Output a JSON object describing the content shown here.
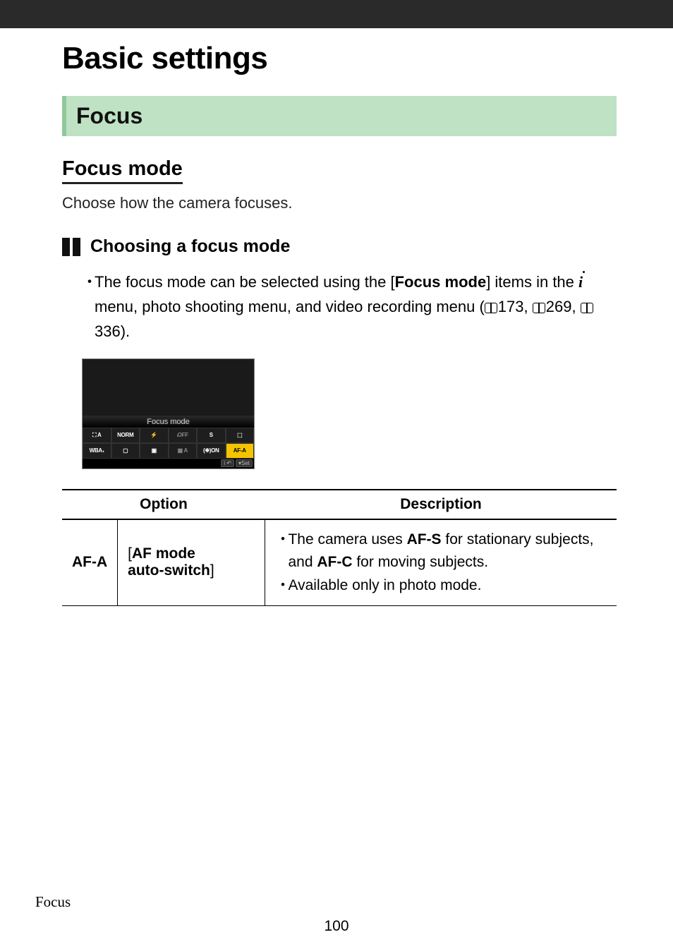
{
  "page": {
    "title": "Basic settings",
    "section_banner": "Focus",
    "subsection": "Focus mode",
    "intro": "Choose how the camera focuses.",
    "choosing_title": "Choosing a focus mode",
    "footer_label": "Focus",
    "page_number": "100"
  },
  "bullet": {
    "pre": "The focus mode can be selected using the [",
    "bold1": "Focus mode",
    "mid1": "] items in the ",
    "mid2": " menu, photo shooting menu, and video recording menu (",
    "ref1": "173",
    "sep1": ", ",
    "ref2": "269",
    "sep2": ", ",
    "ref3": "336",
    "end": ")."
  },
  "lcd": {
    "title": "Focus mode",
    "row1": [
      "⛶ A",
      "NORM",
      "⚡",
      "ᵢOFF",
      "S",
      "⬚"
    ],
    "row2": [
      "WBA₁",
      "▢",
      "▣",
      "▦ A",
      "(❉)ON",
      "AF-A"
    ],
    "footer": [
      "i ↶",
      "▾Set"
    ]
  },
  "table": {
    "headers": {
      "option": "Option",
      "description": "Description"
    },
    "rows": [
      {
        "code": "AF-A",
        "name_pre": "[",
        "name_bold": "AF mode auto‑switch",
        "name_post": "]",
        "desc": [
          {
            "pre": "The camera uses ",
            "b1": "AF‑S",
            "mid": " for stationary subjects, and ",
            "b2": "AF‑C",
            "post": " for moving subjects."
          },
          {
            "plain": "Available only in photo mode."
          }
        ]
      }
    ]
  }
}
